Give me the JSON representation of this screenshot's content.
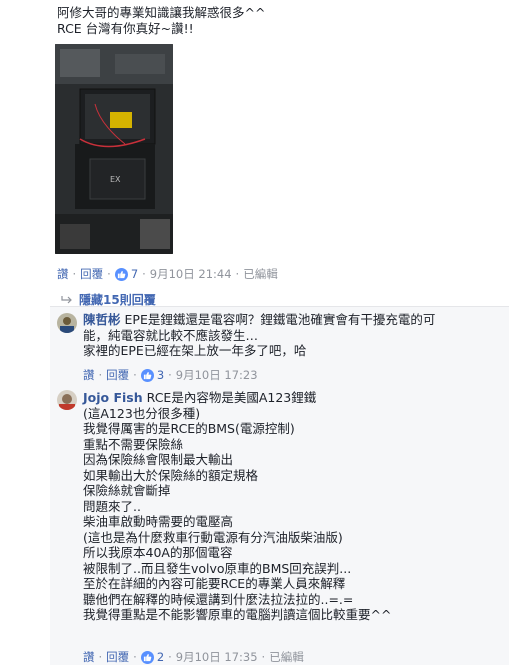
{
  "post": {
    "lines": [
      "阿修大哥的專業知識讓我解惑很多^^",
      "RCE 台灣有你真好~讚!!"
    ],
    "actions": {
      "like": "讚",
      "reply": "回覆",
      "likes": "7",
      "time": "9月10日 21:44",
      "edited": "已編輯"
    }
  },
  "hidden_replies": {
    "label": "隱藏15則回覆"
  },
  "replies": [
    {
      "author": "陳哲彬",
      "lines": [
        "EPE是鋰鐵還是電容啊？鋰鐵電池確實會有干擾充電的可",
        "能，純電容就比較不應該發生…",
        "家裡的EPE已經在架上放一年多了吧，哈"
      ],
      "actions": {
        "like": "讚",
        "reply": "回覆",
        "likes": "3",
        "time": "9月10日 17:23"
      }
    },
    {
      "author": "Jojo Fish",
      "lines": [
        "RCE是內容物是美國A123鋰鐵",
        "(這A123也分很多種)",
        "我覺得厲害的是RCE的BMS(電源控制)",
        "重點不需要保險絲",
        "因為保險絲會限制最大輸出",
        "如果輸出大於保險絲的額定規格",
        "保險絲就會斷掉",
        "問題來了..",
        "柴油車啟動時需要的電壓高",
        "(這也是為什麼救車行動電源有分汽油版柴油版)",
        "所以我原本40A的那個電容",
        "被限制了..而且發生volvo原車的BMS回充誤判...",
        "至於在詳細的內容可能要RCE的專業人員來解釋",
        "聽他們在解釋的時候還講到什麼法拉法拉的..=.=",
        "我覺得重點是不能影響原車的電腦判讀這個比較重要^^"
      ],
      "actions": {
        "like": "讚",
        "reply": "回覆",
        "likes": "2",
        "time": "9月10日 17:35",
        "edited": "已編輯"
      }
    }
  ],
  "colors": {
    "link": "#4267b2",
    "author": "#365899",
    "meta": "#90949c",
    "like_badge": "#5890ff",
    "reply_bg": "#f6f7f9"
  },
  "icons": {
    "like": "thumbs-up-icon",
    "reply": "reply-arrow-icon"
  }
}
